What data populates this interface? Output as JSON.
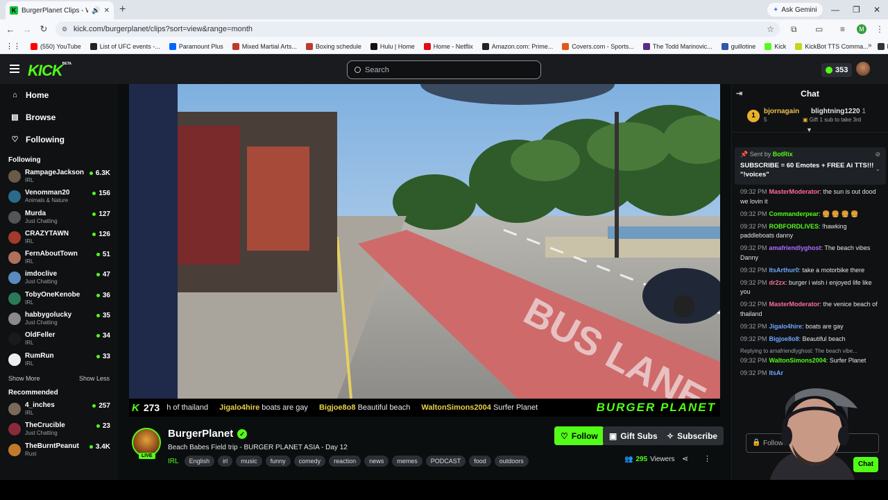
{
  "browser": {
    "tab_title": "BurgerPlanet Clips - Watch",
    "tab_audio_icon": "speaker-icon",
    "new_tab": "+",
    "gemini_label": "Ask Gemini",
    "url": "kick.com/burgerplanet/clips?sort=view&range=month",
    "profile_initial": "M",
    "bookmarks": [
      {
        "label": "(550) YouTube",
        "color": "#ff0000"
      },
      {
        "label": "List of UFC events -...",
        "color": "#222222"
      },
      {
        "label": "Paramount Plus",
        "color": "#0064ff"
      },
      {
        "label": "Mixed Martial Arts...",
        "color": "#c0392b"
      },
      {
        "label": "Boxing schedule",
        "color": "#c0392b"
      },
      {
        "label": "Hulu | Home",
        "color": "#111111"
      },
      {
        "label": "Home - Netflix",
        "color": "#e50914"
      },
      {
        "label": "Amazon.com: Prime...",
        "color": "#222222"
      },
      {
        "label": "Covers.com - Sports...",
        "color": "#e05a1a"
      },
      {
        "label": "The Todd Marinovic...",
        "color": "#5b2c83"
      },
      {
        "label": "guillotine",
        "color": "#3355aa"
      },
      {
        "label": "Kick",
        "color": "#53fc18"
      },
      {
        "label": "KickBot TTS Comma...",
        "color": "#c8d41a"
      },
      {
        "label": "botrix",
        "color": "#333333"
      }
    ]
  },
  "header": {
    "logo": "KICK",
    "logo_beta": "BETA",
    "search_placeholder": "Search",
    "points": "353"
  },
  "sidebar": {
    "nav": [
      {
        "label": "Home",
        "icon": "home-icon",
        "glyph": "⌂"
      },
      {
        "label": "Browse",
        "icon": "browse-icon",
        "glyph": "▤"
      },
      {
        "label": "Following",
        "icon": "heart-icon",
        "glyph": "♡"
      }
    ],
    "following_title": "Following",
    "following": [
      {
        "name": "RampageJackson",
        "category": "IRL",
        "viewers": "6.3K",
        "color": "#6a5a4a"
      },
      {
        "name": "Venomman20",
        "category": "Animals & Nature",
        "viewers": "156",
        "color": "#2a6a8a"
      },
      {
        "name": "Murda",
        "category": "Just Chatting",
        "viewers": "127",
        "color": "#555555"
      },
      {
        "name": "CRAZYTAWN",
        "category": "IRL",
        "viewers": "126",
        "color": "#a33a2a"
      },
      {
        "name": "FernAboutTown",
        "category": "IRL",
        "viewers": "51",
        "color": "#b0705a"
      },
      {
        "name": "imdoclive",
        "category": "Just Chatting",
        "viewers": "47",
        "color": "#5a8ac0"
      },
      {
        "name": "TobyOneKenobe",
        "category": "IRL",
        "viewers": "36",
        "color": "#2a7a5a"
      },
      {
        "name": "habbygolucky",
        "category": "Just Chatting",
        "viewers": "35",
        "color": "#8a8a8a"
      },
      {
        "name": "OldFeller",
        "category": "IRL",
        "viewers": "34",
        "color": "#1a1a1a"
      },
      {
        "name": "RumRun",
        "category": "IRL",
        "viewers": "33",
        "color": "#eeeeee"
      }
    ],
    "show_more": "Show More",
    "show_less": "Show Less",
    "recommended_title": "Recommended",
    "recommended": [
      {
        "name": "4_inches",
        "category": "IRL",
        "viewers": "257",
        "color": "#7a6a5a"
      },
      {
        "name": "TheCrucible",
        "category": "Just Chatting",
        "viewers": "23",
        "color": "#8a2a3a"
      },
      {
        "name": "TheBurntPeanut",
        "category": "Rust",
        "viewers": "3.4K",
        "color": "#c07a2a"
      }
    ]
  },
  "ticker": {
    "count": "273",
    "items": [
      {
        "user": "",
        "text": "h of thailand"
      },
      {
        "user": "Jigalo4hire",
        "text": "boats are gay"
      },
      {
        "user": "Bigjoe8o8",
        "text": "Beautiful beach"
      },
      {
        "user": "WaltonSimons2004",
        "text": "Surfer Planet"
      }
    ],
    "brand": "BURGER PLANET"
  },
  "video_overlay": {
    "street_text": "BUS LANE"
  },
  "stream": {
    "name": "BurgerPlanet",
    "live": "LIVE",
    "title": "Beach Babes Field trip - BURGER PLANET ASIA - Day 12",
    "category": "IRL",
    "tags": [
      "English",
      "irl",
      "music",
      "funny",
      "comedy",
      "reaction",
      "news",
      "memes",
      "PODCAST",
      "food",
      "outdoors"
    ],
    "follow": "Follow",
    "gift": "Gift Subs",
    "subscribe": "Subscribe",
    "viewers": "295",
    "viewers_label": "Viewers"
  },
  "chat": {
    "title": "Chat",
    "gifter1": {
      "rank": "1",
      "name": "bjornagain",
      "count": "5"
    },
    "gifter2": {
      "name": "blightning1220",
      "count": "1",
      "note": "Gift 1 sub to take 3rd"
    },
    "pinned": {
      "by_prefix": "Sent by",
      "by": "BotRix",
      "text": "SUBSCRIBE = 60 Emotes + FREE Ai TTS!!! \"!voices\""
    },
    "messages": [
      {
        "time": "09:32 PM",
        "user": "MasterModerator",
        "color": "#ff6b9a",
        "text": ": the sun is out dood we lovin it"
      },
      {
        "time": "09:32 PM",
        "user": "Commanderpear",
        "color": "#53fc18",
        "text": ": 🍔 🍔 🍔 🍔"
      },
      {
        "time": "09:32 PM",
        "user": "ROBFORDLIVES",
        "color": "#53fc18",
        "text": ": !hawking paddleboats danny"
      },
      {
        "time": "09:32 PM",
        "user": "amafriendlyghost",
        "color": "#b06cff",
        "text": ": The beach vibes Danny"
      },
      {
        "time": "09:32 PM",
        "user": "ItsArthur0",
        "color": "#6ca8ff",
        "text": ": take a motorbike there"
      },
      {
        "time": "09:32 PM",
        "user": "dr2zx",
        "color": "#ff6b9a",
        "text": ": burger i wish i enjoyed life like you"
      },
      {
        "time": "09:32 PM",
        "user": "MasterModerator",
        "color": "#ff6b9a",
        "text": ": the venice beach of thailand"
      },
      {
        "time": "09:32 PM",
        "user": "Jigalo4hire",
        "color": "#6ca8ff",
        "text": ": boats are gay"
      },
      {
        "time": "09:32 PM",
        "user": "Bigjoe8o8",
        "color": "#6ca8ff",
        "text": ": Beautiful beach"
      }
    ],
    "reply_note": "Replying to amafriendlyghost: The beach vibe...",
    "last": {
      "time": "09:32 PM",
      "user": "WaltonSimons2004",
      "color": "#53fc18",
      "text": ": Surfer Planet"
    },
    "partial": {
      "time": "09:32 PM",
      "user": "ItsAr"
    },
    "followers_placeholder": "Followers only",
    "chat_button": "Chat"
  }
}
